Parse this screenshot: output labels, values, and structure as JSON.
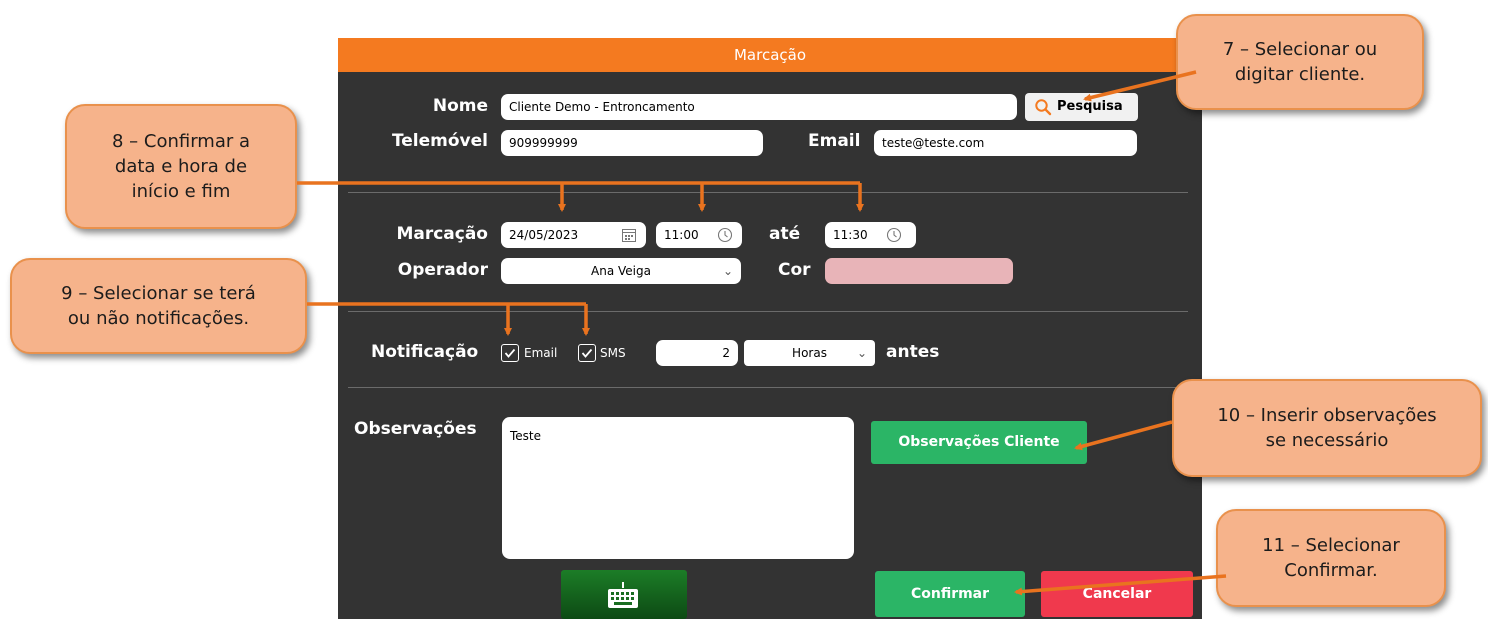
{
  "dialog": {
    "title": "Marcação",
    "client": {
      "name_label": "Nome",
      "name_value": "Cliente Demo - Entroncamento",
      "search_label": "Pesquisa",
      "phone_label": "Telemóvel",
      "phone_value": "909999999",
      "email_label": "Email",
      "email_value": "teste@teste.com"
    },
    "schedule": {
      "label": "Marcação",
      "date": "24/05/2023",
      "start": "11:00",
      "until_label": "até",
      "end": "11:30",
      "operator_label": "Operador",
      "operator_value": "Ana Veiga",
      "color_label": "Cor",
      "color_value": "#e8b4b8"
    },
    "notification": {
      "label": "Notificação",
      "email_label": "Email",
      "email_checked": true,
      "sms_label": "SMS",
      "sms_checked": true,
      "amount": "2",
      "unit": "Horas",
      "before_label": "antes"
    },
    "notes": {
      "label": "Observações",
      "value": "Teste",
      "client_notes_button": "Observações Cliente"
    },
    "actions": {
      "confirm": "Confirmar",
      "cancel": "Cancelar"
    }
  },
  "callouts": {
    "c7": "7 – Selecionar ou\ndigitar cliente.",
    "c8": "8 – Confirmar a\ndata e hora de\ninício e fim",
    "c9": "9 – Selecionar se terá\nou não notificações.",
    "c10": "10 – Inserir observações\nse necessário",
    "c11": "11 – Selecionar\nConfirmar."
  },
  "colors": {
    "accent": "#f47a20",
    "callout_fill": "#f6b38b",
    "dialog_bg": "#333333",
    "confirm": "#2bb566",
    "cancel": "#f0394d"
  }
}
